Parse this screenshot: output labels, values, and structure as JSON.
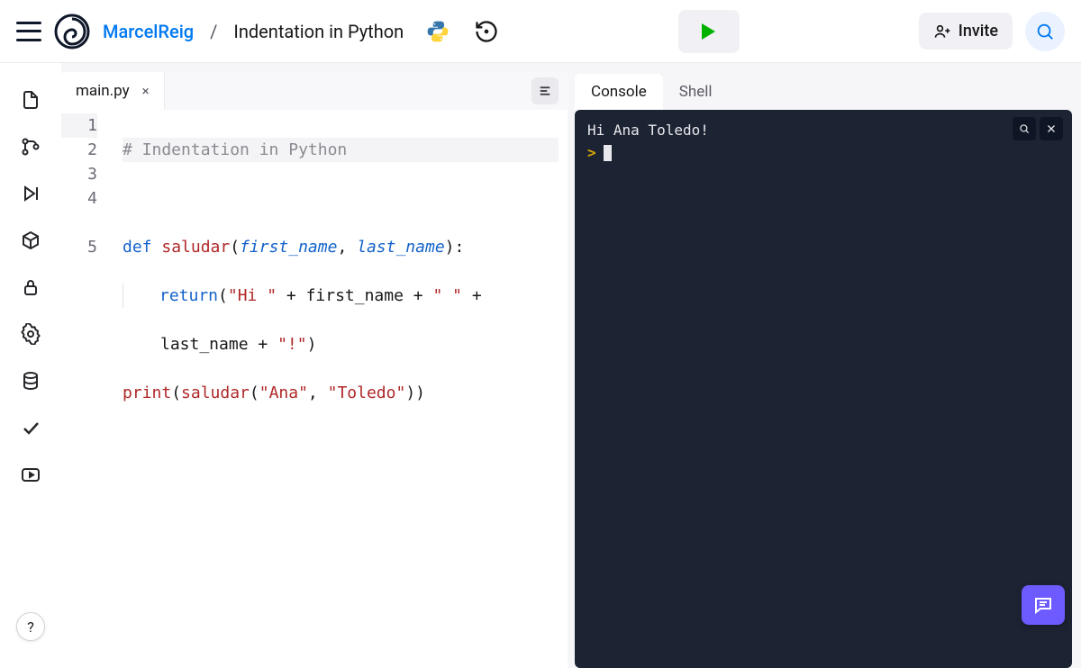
{
  "header": {
    "owner": "MarcelReig",
    "separator": "/",
    "repl_name": "Indentation in Python",
    "invite_label": "Invite"
  },
  "editor": {
    "tab": {
      "filename": "main.py",
      "close": "×"
    },
    "lines": [
      "1",
      "2",
      "3",
      "4",
      "5"
    ],
    "code": {
      "l1_comment": "# Indentation in Python",
      "l3_def": "def",
      "l3_fn": "saludar",
      "l3_open": "(",
      "l3_p1": "first_name",
      "l3_comma": ",",
      "l3_p2": "last_name",
      "l3_close": "):",
      "l4_return": "return",
      "l4_open": "(",
      "l4_s1": "\"Hi \"",
      "l4_plus1": " + ",
      "l4_v1": "first_name",
      "l4_plus2": " + ",
      "l4_s2": "\" \"",
      "l4_plus3": " + ",
      "l4w_v2": "last_name",
      "l4w_plus4": " + ",
      "l4w_s3": "\"!\"",
      "l4w_close": ")",
      "l5_print": "print",
      "l5_open": "(",
      "l5_call": "saludar",
      "l5_open2": "(",
      "l5_a1": "\"Ana\"",
      "l5_comma": ",",
      "l5_a2": "\"Toledo\"",
      "l5_close": "))"
    }
  },
  "console": {
    "tabs": {
      "console": "Console",
      "shell": "Shell"
    },
    "output": "Hi Ana Toledo!",
    "prompt": ">"
  },
  "help": "?"
}
